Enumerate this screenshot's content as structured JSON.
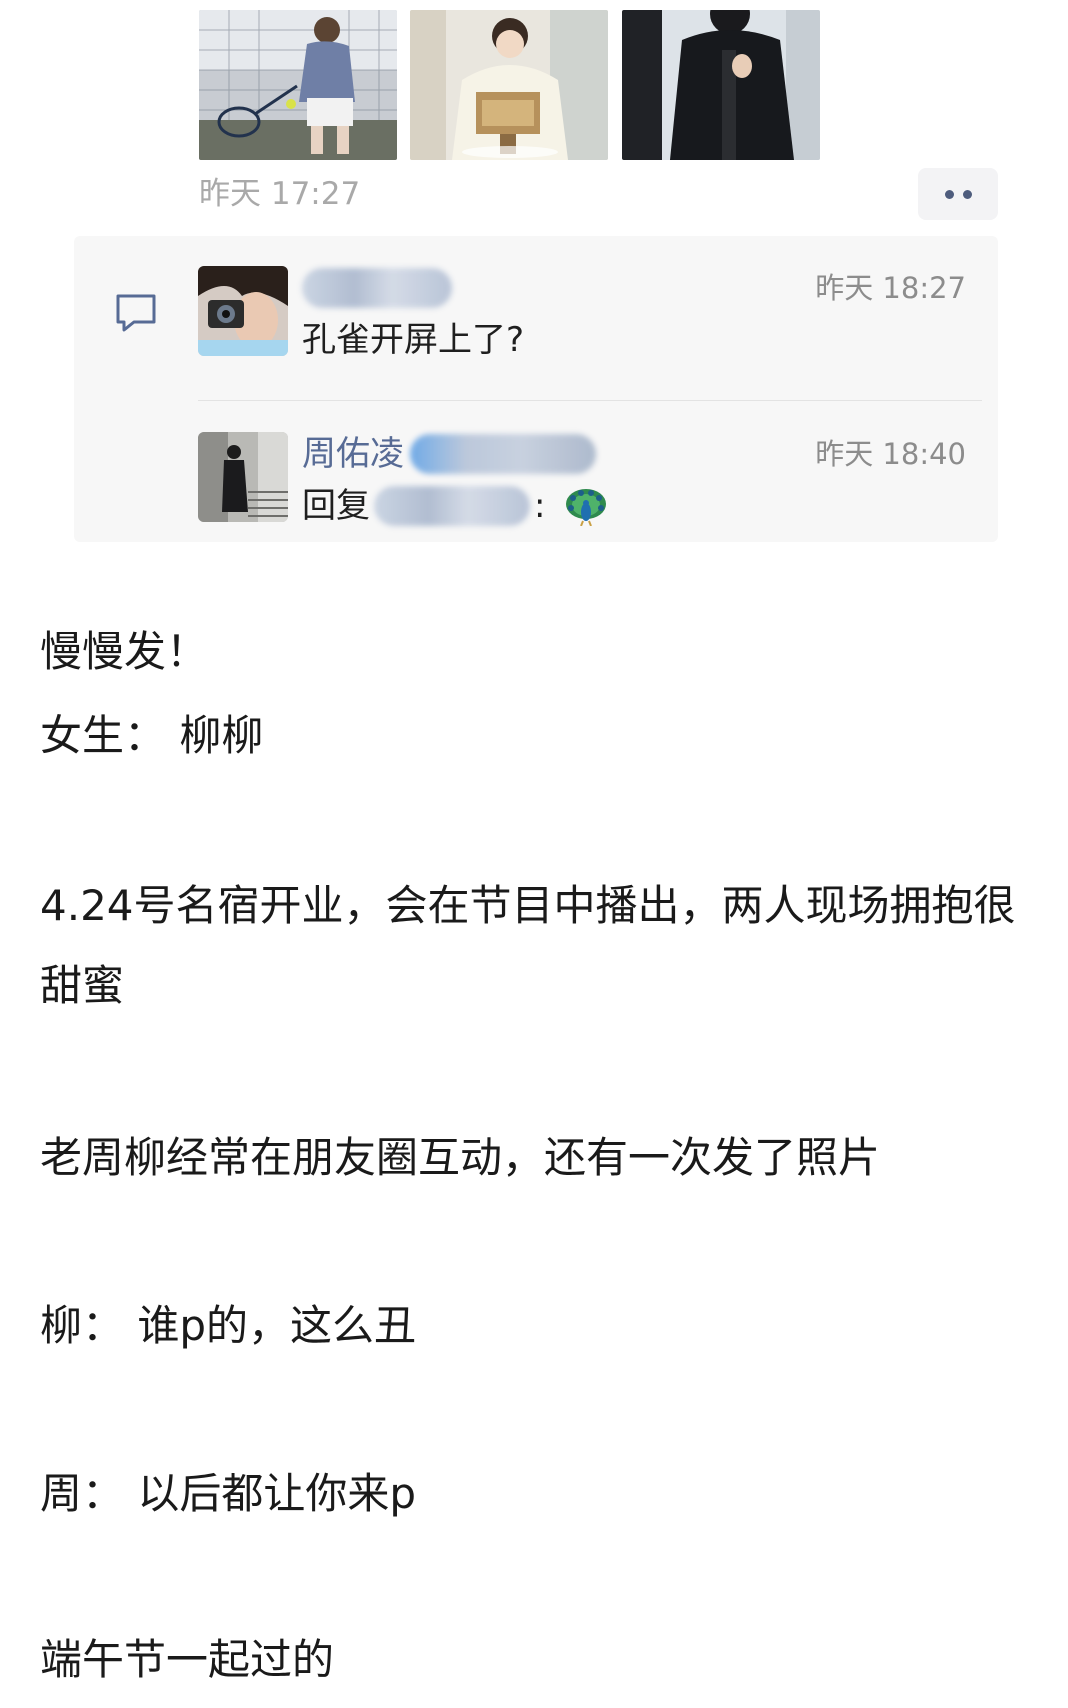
{
  "post": {
    "photos": [
      {
        "icon": "photo-man-tennis"
      },
      {
        "icon": "photo-man-sweater"
      },
      {
        "icon": "photo-man-black-coat"
      }
    ],
    "time": "昨天 17:27",
    "more_icon": "more-dots-icon"
  },
  "comments": {
    "icon": "comment-bubble-icon",
    "items": [
      {
        "name": "",
        "time": "昨天 18:27",
        "text": "孔雀开屏上了?"
      },
      {
        "name": "周佑凌",
        "time": "昨天 18:40",
        "reply_prefix": "回复",
        "reply_suffix": ":",
        "emoji": "peacock-emoji"
      }
    ]
  },
  "article": {
    "p1": "慢慢发！",
    "p2": "女生：  柳柳",
    "p3": "4.24号名宿开业，会在节目中播出，两人现场拥抱很甜蜜",
    "p4": "老周柳经常在朋友圈互动，还有一次发了照片",
    "p5": "柳：  谁p的，这么丑",
    "p6": "周：  以后都让你来p",
    "p7": "端午节一起过的"
  },
  "colors": {
    "link_name": "#576b95",
    "time_gray": "#a9a9a9",
    "panel_bg": "#f7f7f7"
  }
}
